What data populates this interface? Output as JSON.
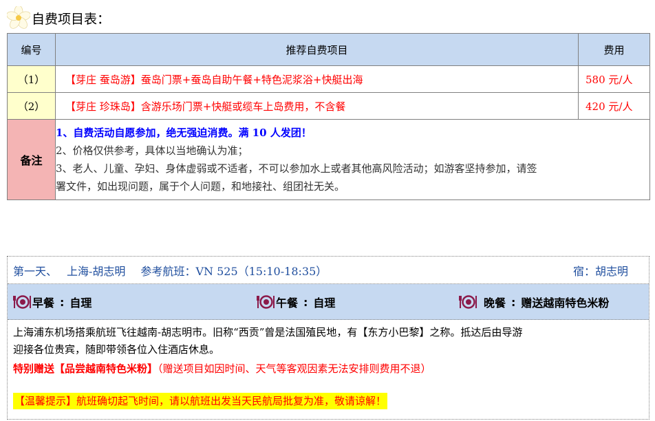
{
  "section_title": "自费项目表：",
  "table": {
    "headers": {
      "num": "编号",
      "project": "推荐自费项目",
      "price": "费用"
    },
    "rows": [
      {
        "num": "（1）",
        "project": "【芽庄 蚕岛游】蚕岛门票+蚕岛自助午餐+特色泥浆浴+快艇出海",
        "price": "580 元/人"
      },
      {
        "num": "（2）",
        "project": "【芽庄 珍珠岛】含游乐场门票+快艇或缆车上岛费用，不含餐",
        "price": "420 元/人"
      }
    ],
    "notes": {
      "label": "备注",
      "lines": [
        "1、自费活动自愿参加，绝无强迫消费。满 10 人发团！",
        "2、价格仅供参考，具体以当地确认为准；",
        "3、老人、儿童、孕妇、身体虚弱或不适者，不可以参加水上或者其他高风险活动；如游客坚持参加，请签",
        "署文件，如出现问题，属于个人问题，和地接社、组团社无关。"
      ]
    }
  },
  "day": {
    "day_label": "第一天、",
    "route": "上海-胡志明",
    "flight": "参考航班：VN 525（15:10-18:35）",
    "stay": "宿：胡志明",
    "meals": {
      "breakfast_label": "早餐",
      "breakfast_value": "自理",
      "lunch_label": "午餐",
      "lunch_value": "自理",
      "dinner_label": "晚餐",
      "dinner_value": "赠送越南特色米粉",
      "separator": ":"
    },
    "description_line1": "上海浦东机场搭乘航班飞往越南-胡志明市。旧称“西贡”曾是法国殖民地，有【东方小巴黎】之称。抵达后由导游",
    "description_line2": "迎接各位贵宾，随即带领各位入住酒店休息。",
    "gift_bold": "特别赠送【品尝越南特色米粉】",
    "gift_note": "（赠送项目如因时间、天气等客观因素无法安排则费用不退）",
    "tip": "【温馨提示】航班确切起飞时间，请以航班出发当天民航局批复为准，敬请谅解！"
  },
  "colors": {
    "header_blue": "#c6d9f1",
    "num_yellow": "#ffffcc",
    "note_pink": "#f4b4b4",
    "red_text": "#ff0000",
    "blue_text": "#0000ff",
    "day_blue": "#1f4e9e",
    "tip_highlight": "#ffff00",
    "meal_icon": "#8b1a4a"
  },
  "icons": [
    "flower-icon",
    "plate-cutlery-icon"
  ]
}
